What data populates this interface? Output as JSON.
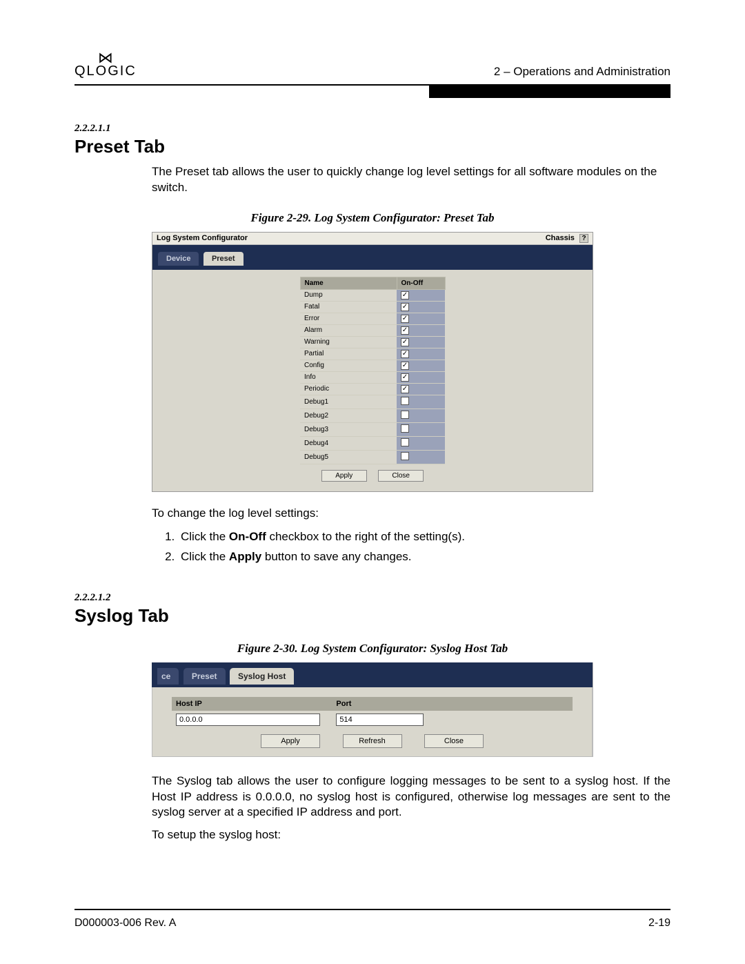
{
  "header": {
    "logo_mark": "⋈",
    "logo_text": "QLOGIC",
    "chapter": "2 – Operations and Administration"
  },
  "section1": {
    "num": "2.2.2.1.1",
    "title": "Preset Tab",
    "intro": "The Preset tab allows the user to quickly change log level settings for all software modules on the switch.",
    "figcap": "Figure 2-29. Log System Configurator: Preset Tab",
    "lead2": "To change the log level settings:",
    "step1_a": "Click the ",
    "step1_b": "On-Off",
    "step1_c": " checkbox to the right of the setting(s).",
    "step2_a": "Click the ",
    "step2_b": "Apply",
    "step2_c": " button to save any changes."
  },
  "fig1": {
    "wintitle": "Log System Configurator",
    "chassis": "Chassis",
    "help": "?",
    "tab_device": "Device",
    "tab_preset": "Preset",
    "col_name": "Name",
    "col_onoff": "On-Off",
    "rows": [
      {
        "name": "Dump",
        "on": true
      },
      {
        "name": "Fatal",
        "on": true
      },
      {
        "name": "Error",
        "on": true
      },
      {
        "name": "Alarm",
        "on": true
      },
      {
        "name": "Warning",
        "on": true
      },
      {
        "name": "Partial",
        "on": true
      },
      {
        "name": "Config",
        "on": true
      },
      {
        "name": "Info",
        "on": true
      },
      {
        "name": "Periodic",
        "on": true
      },
      {
        "name": "Debug1",
        "on": false
      },
      {
        "name": "Debug2",
        "on": false
      },
      {
        "name": "Debug3",
        "on": false
      },
      {
        "name": "Debug4",
        "on": false
      },
      {
        "name": "Debug5",
        "on": false
      }
    ],
    "btn_apply": "Apply",
    "btn_close": "Close"
  },
  "section2": {
    "num": "2.2.2.1.2",
    "title": "Syslog Tab",
    "figcap": "Figure 2-30. Log System Configurator: Syslog Host Tab",
    "para": "The Syslog tab allows the user to configure logging messages to be sent to a syslog host. If the Host IP address is 0.0.0.0, no syslog host is configured, otherwise log messages are sent to the syslog server at a specified IP address and port.",
    "lead2": "To setup the syslog host:"
  },
  "fig2": {
    "tab_ce": "ce",
    "tab_preset": "Preset",
    "tab_syslog": "Syslog Host",
    "col_host": "Host IP",
    "col_port": "Port",
    "val_host": "0.0.0.0",
    "val_port": "514",
    "btn_apply": "Apply",
    "btn_refresh": "Refresh",
    "btn_close": "Close"
  },
  "footer": {
    "doc": "D000003-006 Rev. A",
    "page": "2-19"
  }
}
